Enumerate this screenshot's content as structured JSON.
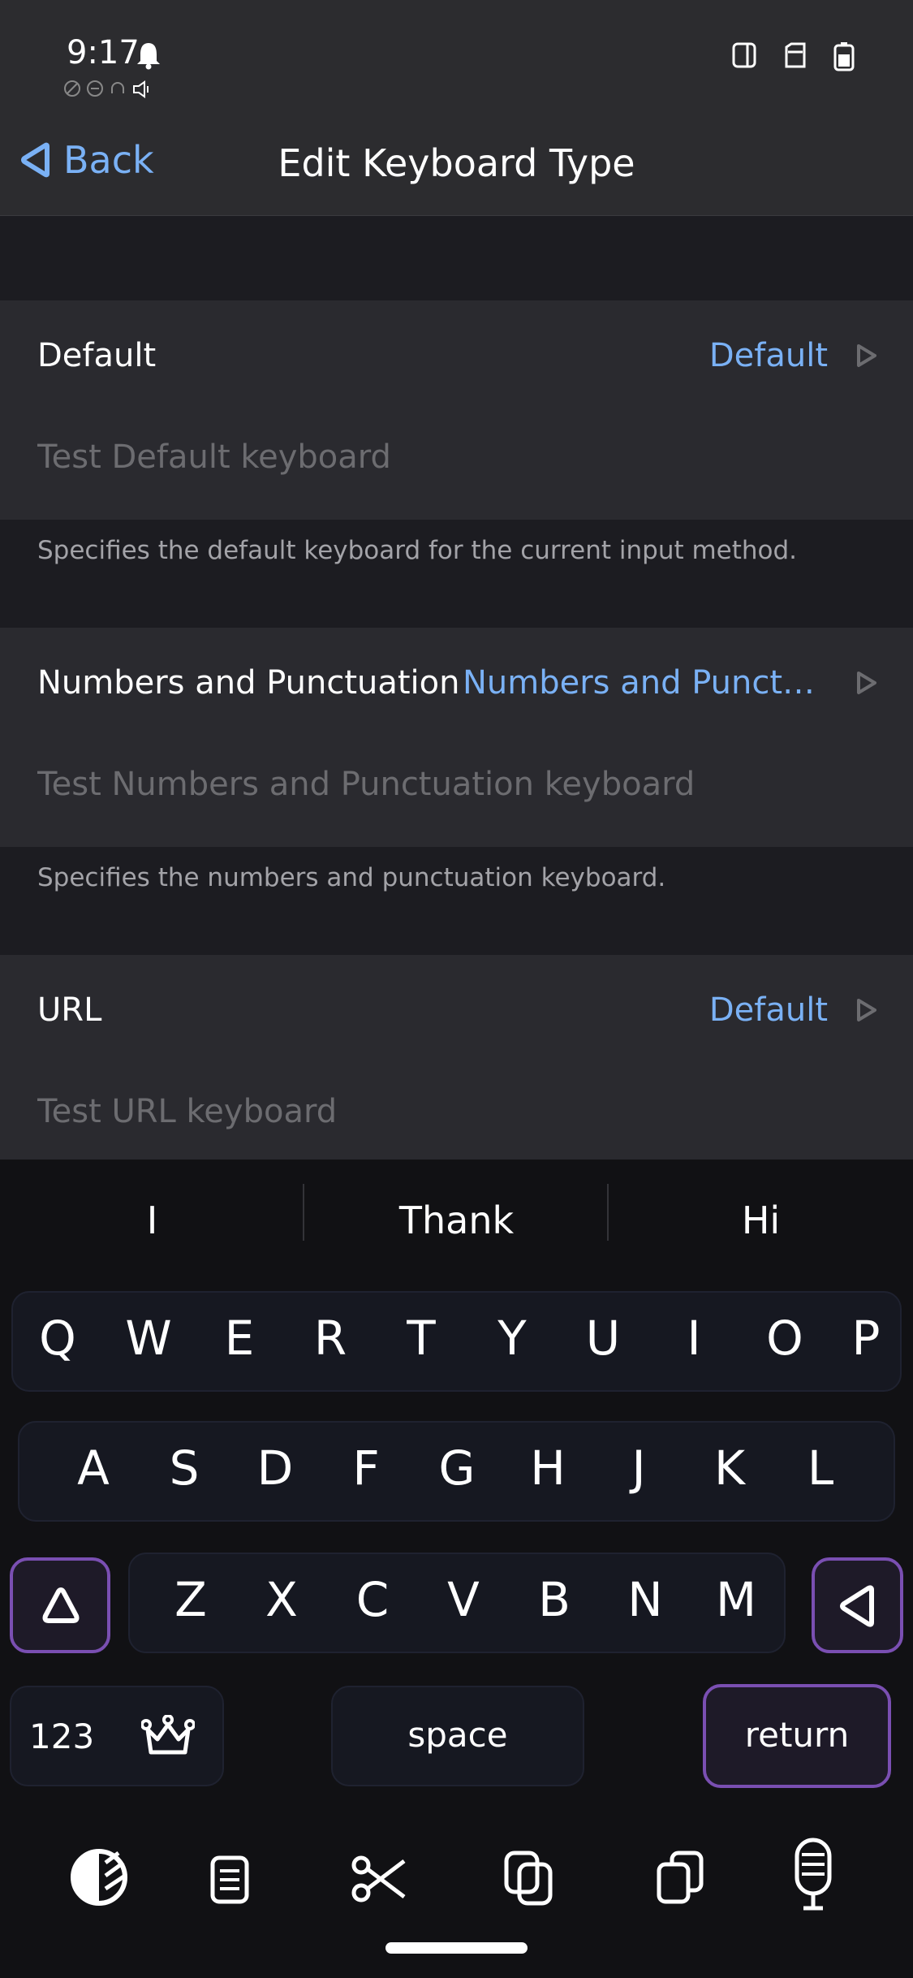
{
  "status_bar": {
    "time": "9:17"
  },
  "nav": {
    "back_label": "Back",
    "title": "Edit Keyboard Type"
  },
  "sections": [
    {
      "label": "Default",
      "value": "Default",
      "placeholder": "Test Default keyboard",
      "footnote": "Specifies the default keyboard for the current input method."
    },
    {
      "label": "Numbers and Punctuation",
      "value": "Numbers and Punctu…",
      "placeholder": "Test Numbers and Punctuation keyboard",
      "footnote": "Specifies the numbers and punctuation keyboard."
    },
    {
      "label": "URL",
      "value": "Default",
      "placeholder": "Test URL keyboard"
    }
  ],
  "keyboard": {
    "suggestions": [
      "I",
      "Thank",
      "Hi"
    ],
    "row1": [
      "Q",
      "W",
      "E",
      "R",
      "T",
      "Y",
      "U",
      "I",
      "O",
      "P"
    ],
    "row2": [
      "A",
      "S",
      "D",
      "F",
      "G",
      "H",
      "J",
      "K",
      "L"
    ],
    "row3": [
      "Z",
      "X",
      "C",
      "V",
      "B",
      "N",
      "M"
    ],
    "numbers_label": "123",
    "space_label": "space",
    "return_label": "return"
  },
  "toolbar": {
    "icons": [
      "theme-icon",
      "clipboard-icon",
      "scissors-icon",
      "copy-icon",
      "paste-icon",
      "microphone-icon"
    ]
  },
  "colors": {
    "accent": "#7ab1f5",
    "special_key_border": "#7a4fb2",
    "background": "#1c1c21",
    "cell": "#2a2a2f"
  }
}
